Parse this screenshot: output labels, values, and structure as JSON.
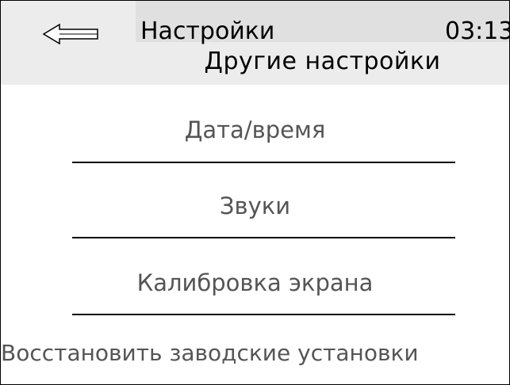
{
  "header": {
    "title": "Настройки",
    "time": "03:13",
    "subtitle": "Другие настройки",
    "back_icon": "arrow-left-icon"
  },
  "menu": {
    "items": [
      {
        "label": "Дата/время"
      },
      {
        "label": "Звуки"
      },
      {
        "label": "Калибровка экрана"
      },
      {
        "label": "Восстановить заводские установки"
      }
    ]
  },
  "colors": {
    "header_background": "#ececec",
    "header_title_strip": "#e0e0e0",
    "menu_text": "#555555",
    "divider": "#000000"
  }
}
